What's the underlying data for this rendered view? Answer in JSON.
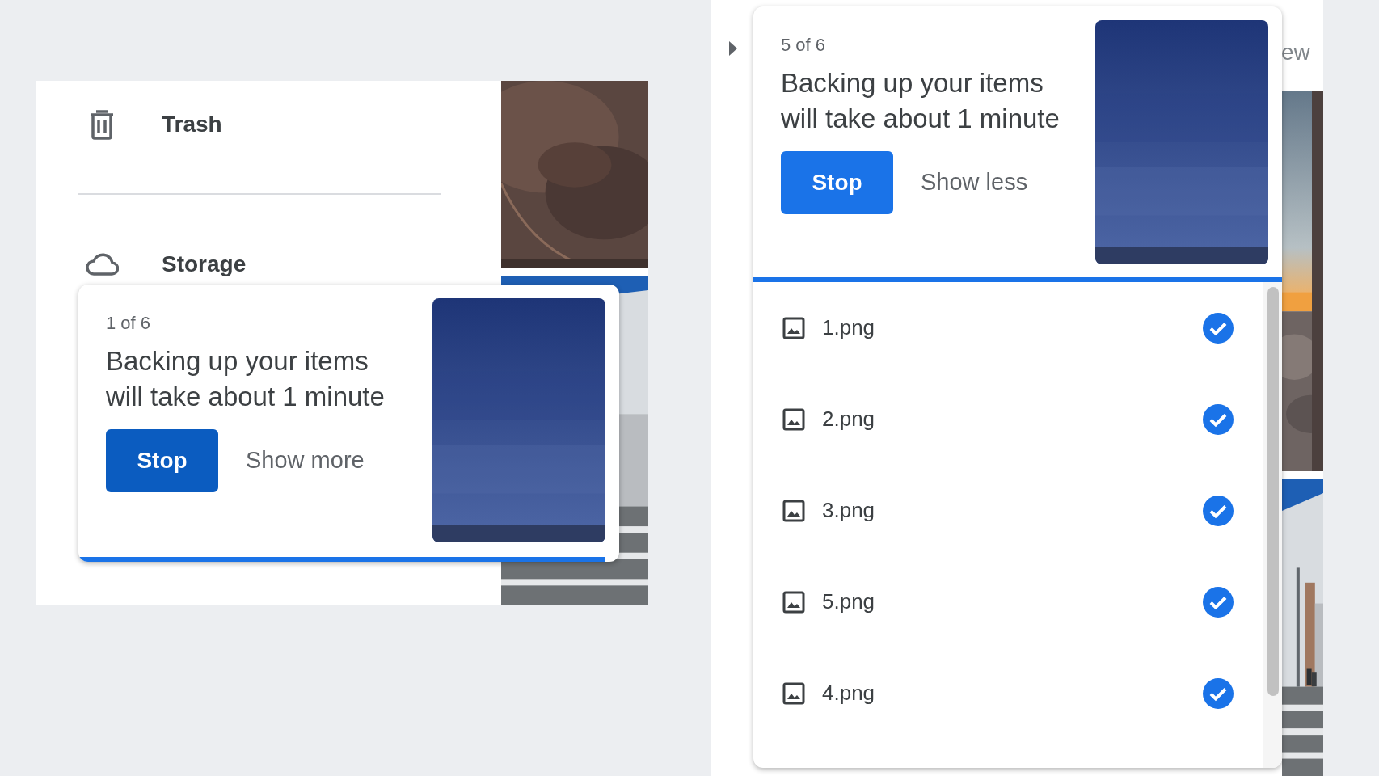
{
  "left_panel": {
    "nav_items": [
      {
        "label": "Trash"
      },
      {
        "label": "Storage"
      }
    ],
    "backup_card": {
      "counter": "1 of 6",
      "message": "Backing up your items will take about 1 minute",
      "stop_button": {
        "label": "Stop",
        "pressed": true
      },
      "toggle_link": "Show more",
      "level": 0.975
    }
  },
  "right_panel": {
    "clipped_label": "ew",
    "backup_card": {
      "counter": "5 of 6",
      "message": "Backing up your items will take about 1 minute",
      "stop_button": {
        "label": "Stop",
        "pressed": false
      },
      "toggle_link": "Show less",
      "level": 1
    },
    "files": [
      {
        "name": "1.png",
        "done": true
      },
      {
        "name": "2.png",
        "done": true
      },
      {
        "name": "3.png",
        "done": true
      },
      {
        "name": "5.png",
        "done": true
      },
      {
        "name": "4.png",
        "done": true
      }
    ]
  }
}
